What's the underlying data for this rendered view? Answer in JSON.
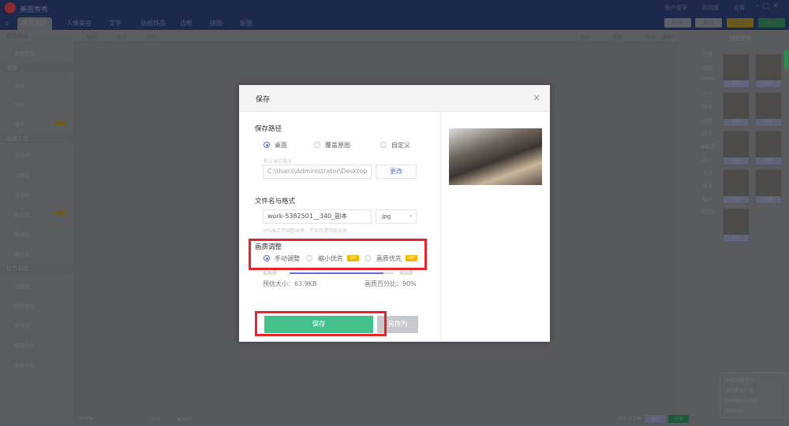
{
  "app": {
    "title": "美图秀秀",
    "tabs": [
      "美化图片",
      "人像美容",
      "文字",
      "贴纸饰品",
      "边框",
      "拼图",
      "抠图"
    ],
    "account": "账户登录",
    "web": "网页版",
    "settings": "设置",
    "buttons": {
      "open": "打开",
      "new": "新建",
      "vip": "会员",
      "save": "保存"
    }
  },
  "toolbar": {
    "tools": [
      "旋转",
      "裁剪",
      "尺寸"
    ],
    "right": [
      "撤销",
      "重做",
      "历史",
      "原图"
    ],
    "effects_title": "特效滤镜"
  },
  "sidebar": {
    "sections": [
      {
        "title": "智能优化",
        "items": [
          {
            "label": "智能优化",
            "vip": false
          }
        ]
      },
      {
        "title": "增强",
        "items": [
          {
            "label": "光效",
            "vip": false
          },
          {
            "label": "色彩",
            "vip": false
          },
          {
            "label": "细节",
            "vip": true
          }
        ]
      },
      {
        "title": "画笔工具",
        "items": [
          {
            "label": "涂鸦笔",
            "vip": false
          },
          {
            "label": "消除笔",
            "vip": false
          },
          {
            "label": "消除笔",
            "vip": false
          },
          {
            "label": "标注笔",
            "vip": true
          },
          {
            "label": "取色笔",
            "vip": false
          },
          {
            "label": "魔幻笔",
            "vip": false
          }
        ]
      },
      {
        "title": "细节调整",
        "items": [
          {
            "label": "马赛克",
            "vip": false
          },
          {
            "label": "背景虚化",
            "vip": false
          },
          {
            "label": "抠背景",
            "vip": false
          },
          {
            "label": "局部变色",
            "vip": false
          },
          {
            "label": "局部彩色",
            "vip": false
          }
        ]
      }
    ],
    "vip_tag": "VIP"
  },
  "effects": {
    "categories": [
      "常用",
      "基础",
      "LOMO",
      "人物",
      "食物",
      "风景",
      "时尚",
      "电影感",
      "胶片",
      "艺术",
      "复古",
      "胶片",
      "霓虹灯"
    ],
    "thumbs": [
      "原图",
      "原图",
      "原图",
      "原图",
      "原图",
      "原图",
      "原图",
      "原图",
      "原图"
    ]
  },
  "ad": {
    "items": [
      "X8智能新手机",
      "直达模板广告",
      "防伪原图不修防",
      "放假贴纸"
    ]
  },
  "status": {
    "zoom": "100%",
    "actual": "原大小",
    "fit": "适应",
    "size": "565 x 340",
    "compare": "对比",
    "share": "分享"
  },
  "dialog": {
    "title": "保存",
    "close": "×",
    "path_label": "保存路径",
    "path_options": [
      "桌面",
      "覆盖原图",
      "自定义"
    ],
    "path_hint": "默认保存路径",
    "path_value": "C:\\Users\\Administrator\\Desktop",
    "change": "更改",
    "name_label": "文件名与格式",
    "filename": "work-5382501__340_副本",
    "format": ".jpg",
    "format_hint": "JPG格式可调整画质，不支持透明度背景",
    "quality_label": "画质调整",
    "quality_options": [
      "手动调整",
      "缩小优先",
      "画质优先"
    ],
    "vip": "VIP",
    "low": "低画质",
    "high": "高画质",
    "quality_percent": 90,
    "est_size": "预估大小：63.9KB",
    "quality_text": "画质百分比：90%",
    "save": "保存",
    "save_as": "另存为"
  }
}
